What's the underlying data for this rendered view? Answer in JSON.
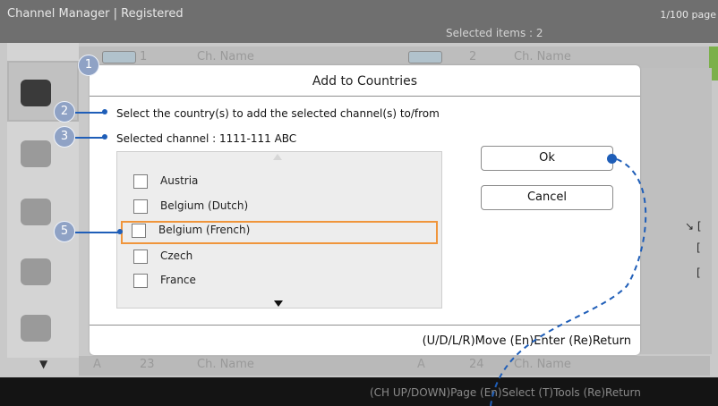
{
  "app": {
    "title": "Channel Manager | Registered",
    "page_indicator": "1/100 page",
    "selected_items": "Selected items : 2"
  },
  "channel_rows": {
    "top": [
      {
        "number": "1",
        "name": "Ch. Name"
      },
      {
        "number": "2",
        "name": "Ch. Name"
      }
    ],
    "bottom": [
      {
        "badge": "A",
        "number": "23",
        "name": "Ch. Name"
      },
      {
        "badge": "A",
        "number": "24",
        "name": "Ch. Name"
      }
    ]
  },
  "dialog": {
    "title": "Add  to Countries",
    "instruction": "Select the country(s) to add the selected channel(s) to/from",
    "selected_channel": "Selected channel : 1111-111 ABC",
    "countries": [
      {
        "label": "Austria",
        "checked": false
      },
      {
        "label": "Belgium (Dutch)",
        "checked": false
      },
      {
        "label": "Belgium (French)",
        "checked": false,
        "focused": true
      },
      {
        "label": "Czech",
        "checked": false
      },
      {
        "label": "France",
        "checked": false
      }
    ],
    "ok_label": "Ok",
    "cancel_label": "Cancel",
    "help": "(U/D/L/R)Move  (En)Enter  (Re)Return"
  },
  "footer": {
    "help": "(CH UP/DOWN)Page  (En)Select  (T)Tools  (Re)Return"
  },
  "callouts": [
    "1",
    "2",
    "3",
    "5"
  ],
  "icons": {
    "scroll_up": "triangle-up-icon",
    "scroll_down": "triangle-down-icon",
    "list_down": "triangle-down-icon"
  },
  "colors": {
    "focus_border": "#f0953b",
    "callout_blue": "#1f5eb8",
    "callout_circle": "#8fa2c5",
    "bottom_bar": "#141414"
  }
}
